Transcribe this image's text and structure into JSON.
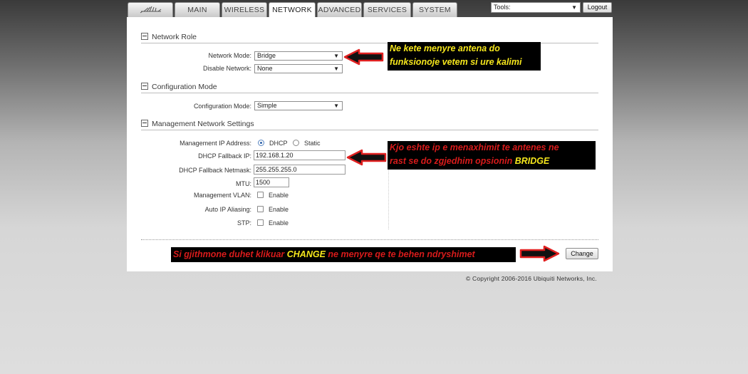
{
  "tabs": {
    "main": "MAIN",
    "wireless": "WIRELESS",
    "network": "NETWORK",
    "advanced": "ADVANCED",
    "services": "SERVICES",
    "system": "SYSTEM"
  },
  "toolbar": {
    "tools_value": "Tools:",
    "logout_label": "Logout"
  },
  "network_role": {
    "title": "Network Role",
    "network_mode_label": "Network Mode:",
    "network_mode_value": "Bridge",
    "disable_network_label": "Disable Network:",
    "disable_network_value": "None"
  },
  "configuration_mode": {
    "title": "Configuration Mode",
    "label": "Configuration Mode:",
    "value": "Simple"
  },
  "management": {
    "title": "Management Network Settings",
    "ip_address_label": "Management IP Address:",
    "dhcp_label": "DHCP",
    "static_label": "Static",
    "fallback_ip_label": "DHCP Fallback IP:",
    "fallback_ip_value": "192.168.1.20",
    "fallback_netmask_label": "DHCP Fallback Netmask:",
    "fallback_netmask_value": "255.255.255.0",
    "mtu_label": "MTU:",
    "mtu_value": "1500",
    "vlan_label": "Management VLAN:",
    "auto_ip_label": "Auto IP Aliasing:",
    "stp_label": "STP:",
    "enable_label": "Enable"
  },
  "actions": {
    "change_label": "Change"
  },
  "annotations": {
    "note1_line1": "Ne kete menyre antena do",
    "note1_line2": "funksionoje vetem si ure kalimi",
    "note2_line1": "Kjo eshte ip e menaxhimit te antenes ne",
    "note2_line2_pre": "rast se do zgjedhim opsionin ",
    "note2_line2_hl": "BRIDGE",
    "note3_pre": "Si gjithmone duhet klikuar ",
    "note3_hl": "CHANGE",
    "note3_post": " ne menyre qe te behen ndryshimet"
  },
  "footer": {
    "copyright": "© Copyright 2006-2016 Ubiquiti Networks, Inc."
  },
  "colors": {
    "annotation_red": "#d81b1b",
    "annotation_yellow": "#f6e71c",
    "arrow_red": "#e02020",
    "radio_blue": "#2a5fa8"
  }
}
